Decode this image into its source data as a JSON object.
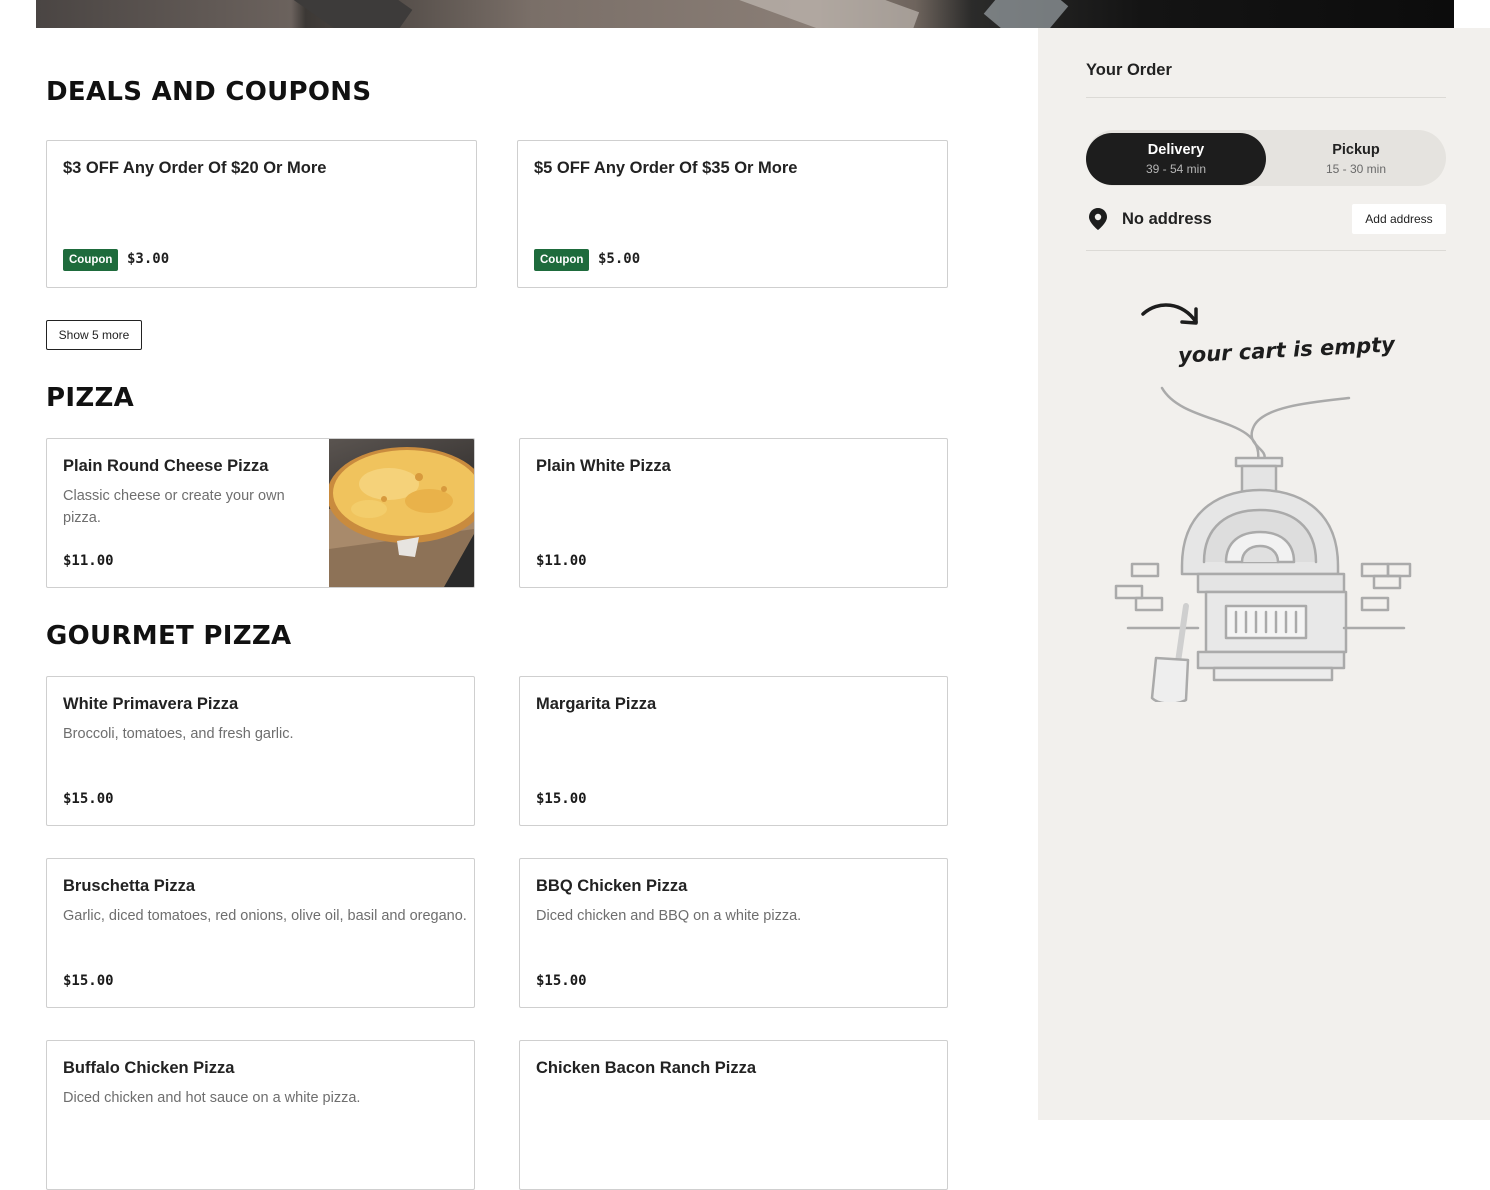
{
  "deals": {
    "title": "DEALS AND COUPONS",
    "items": [
      {
        "name": "$3 OFF Any Order Of $20 Or More",
        "badge": "Coupon",
        "amount": "$3.00"
      },
      {
        "name": "$5 OFF Any Order Of $35 Or More",
        "badge": "Coupon",
        "amount": "$5.00"
      }
    ],
    "show_more_label": "Show 5 more",
    "badge_color": "#1e6b3c"
  },
  "pizza": {
    "title": "PIZZA",
    "items": [
      {
        "name": "Plain Round Cheese Pizza",
        "desc_line1": "Classic cheese or create your own",
        "desc_line2": "pizza.",
        "price": "$11.00"
      },
      {
        "name": "Plain White Pizza",
        "price": "$11.00"
      }
    ]
  },
  "gourmet": {
    "title": "GOURMET PIZZA",
    "items": [
      {
        "name": "White Primavera Pizza",
        "desc": "Broccoli, tomatoes, and fresh garlic.",
        "price": "$15.00"
      },
      {
        "name": "Margarita Pizza",
        "price": "$15.00"
      },
      {
        "name": "Bruschetta Pizza",
        "desc": "Garlic, diced tomatoes, red onions, olive oil, basil and oregano.",
        "price": "$15.00"
      },
      {
        "name": "BBQ Chicken Pizza",
        "desc": "Diced chicken and BBQ on a white pizza.",
        "price": "$15.00"
      },
      {
        "name": "Buffalo Chicken Pizza",
        "desc": "Diced chicken and hot sauce on a white pizza."
      },
      {
        "name": "Chicken Bacon Ranch Pizza"
      }
    ]
  },
  "order": {
    "title": "Your Order",
    "delivery": {
      "label": "Delivery",
      "time": "39 - 54 min"
    },
    "pickup": {
      "label": "Pickup",
      "time": "15 - 30 min"
    },
    "address_text": "No address",
    "add_address_label": "Add address",
    "empty_message": "your cart is empty"
  },
  "colors": {
    "sidebar_bg": "#f2f0ed",
    "toggle_active": "#1d1d1d"
  }
}
